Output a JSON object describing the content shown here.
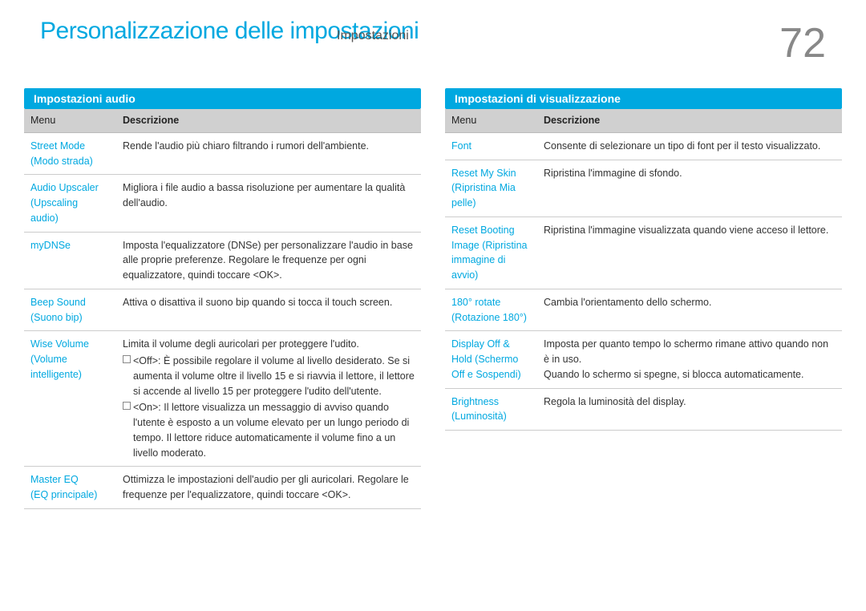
{
  "page": {
    "number": "72",
    "main_title": "Personalizzazione delle impostazioni",
    "sub_title": "Impostazioni"
  },
  "audio_panel": {
    "header": "Impostazioni audio",
    "col_menu": "Menu",
    "col_desc": "Descrizione",
    "rows": [
      {
        "menu": "Street Mode\n(Modo strada)",
        "desc": "Rende l'audio più chiaro filtrando i rumori dell'ambiente."
      },
      {
        "menu": "Audio Upscaler\n(Upscaling\naudio)",
        "desc": "Migliora i file audio a bassa risoluzione per aumentare la qualità dell'audio."
      },
      {
        "menu": "myDNSe",
        "desc": "Imposta l'equalizzatore (DNSe) per personalizzare l'audio in base alle proprie preferenze. Regolare le frequenze per ogni equalizzatore, quindi toccare <OK>."
      },
      {
        "menu": "Beep Sound\n(Suono bip)",
        "desc": "Attiva o disattiva il suono bip quando si tocca il touch screen."
      },
      {
        "menu": "Wise Volume\n(Volume\nintelligente)",
        "desc_parts": {
          "intro": "Limita il volume degli auricolari per proteggere l'udito.",
          "off": "<Off>: È possibile regolare il volume al livello desiderato. Se si aumenta il volume oltre il livello 15 e si riavvia il lettore, il lettore si accende al livello 15 per proteggere l'udito dell'utente.",
          "on": "<On>: Il lettore visualizza un messaggio di avviso quando l'utente è esposto a un volume elevato per un lungo periodo di tempo. Il lettore riduce automaticamente il volume fino a un livello moderato."
        }
      },
      {
        "menu": "Master EQ\n(EQ principale)",
        "desc": "Ottimizza le impostazioni dell'audio per gli auricolari. Regolare le frequenze per l'equalizzatore, quindi toccare <OK>."
      }
    ]
  },
  "display_panel": {
    "header": "Impostazioni di visualizzazione",
    "col_menu": "Menu",
    "col_desc": "Descrizione",
    "rows": [
      {
        "menu": "Font",
        "desc": "Consente di selezionare un tipo di font per il testo visualizzato."
      },
      {
        "menu": "Reset My Skin\n(Ripristina Mia\npelle)",
        "desc": "Ripristina l'immagine di sfondo."
      },
      {
        "menu": "Reset Booting\nImage (Ripristina\nimmagine di\navvio)",
        "desc": "Ripristina l'immagine visualizzata quando viene acceso il lettore."
      },
      {
        "menu": "180° rotate\n(Rotazione 180°)",
        "desc": "Cambia l'orientamento dello schermo."
      },
      {
        "menu": "Display Off &\nHold (Schermo\nOff e Sospendi)",
        "desc": "Imposta per quanto tempo lo schermo rimane attivo quando non è in uso.\nQuando lo schermo si spegne, si blocca automaticamente."
      },
      {
        "menu": "Brightness\n(Luminosità)",
        "desc": "Regola la luminosità del display."
      }
    ]
  }
}
